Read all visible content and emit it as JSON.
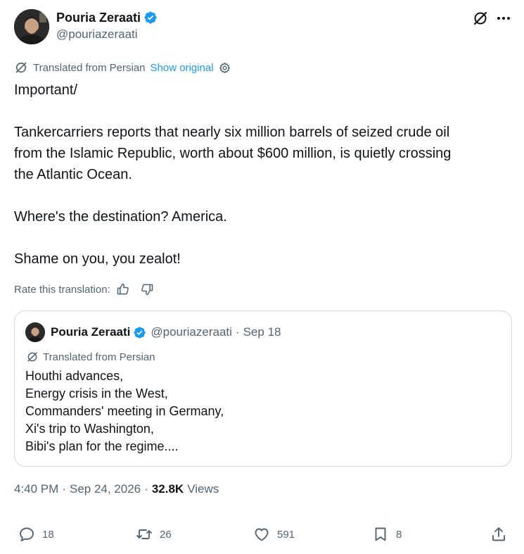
{
  "author": {
    "name": "Pouria Zeraati",
    "handle": "@pouriazeraati",
    "verified": true
  },
  "translation": {
    "label": "Translated from Persian",
    "show_original": "Show original"
  },
  "tweet": {
    "lines": [
      "Important/",
      "",
      "Tankercarriers reports that nearly six million barrels of seized crude oil",
      "from the Islamic Republic, worth about $600 million, is quietly crossing",
      "the Atlantic Ocean.",
      "",
      "Where's the destination? America.",
      "",
      "Shame on you, you zealot!"
    ]
  },
  "rate_translation": {
    "label": "Rate this translation:"
  },
  "quote": {
    "name": "Pouria Zeraati",
    "handle": "@pouriazeraati",
    "date": "Sep 18",
    "translated_label": "Translated from Persian",
    "lines": [
      "Houthi advances,",
      "Energy crisis in the West,",
      "Commanders' meeting in Germany,",
      "Xi's trip to Washington,",
      "Bibi's plan for the regime...."
    ]
  },
  "meta": {
    "time": "4:40 PM",
    "date": "Sep 24, 2026",
    "separator": "·",
    "views_count": "32.8K",
    "views_label": "Views"
  },
  "actions": {
    "replies": "18",
    "retweets": "26",
    "likes": "591",
    "bookmarks": "8"
  },
  "colors": {
    "link": "#1d9bf0",
    "verified": "#1d9bf0",
    "secondary_text": "#536471",
    "primary_text": "#0f1419",
    "border": "#cfd9de"
  }
}
